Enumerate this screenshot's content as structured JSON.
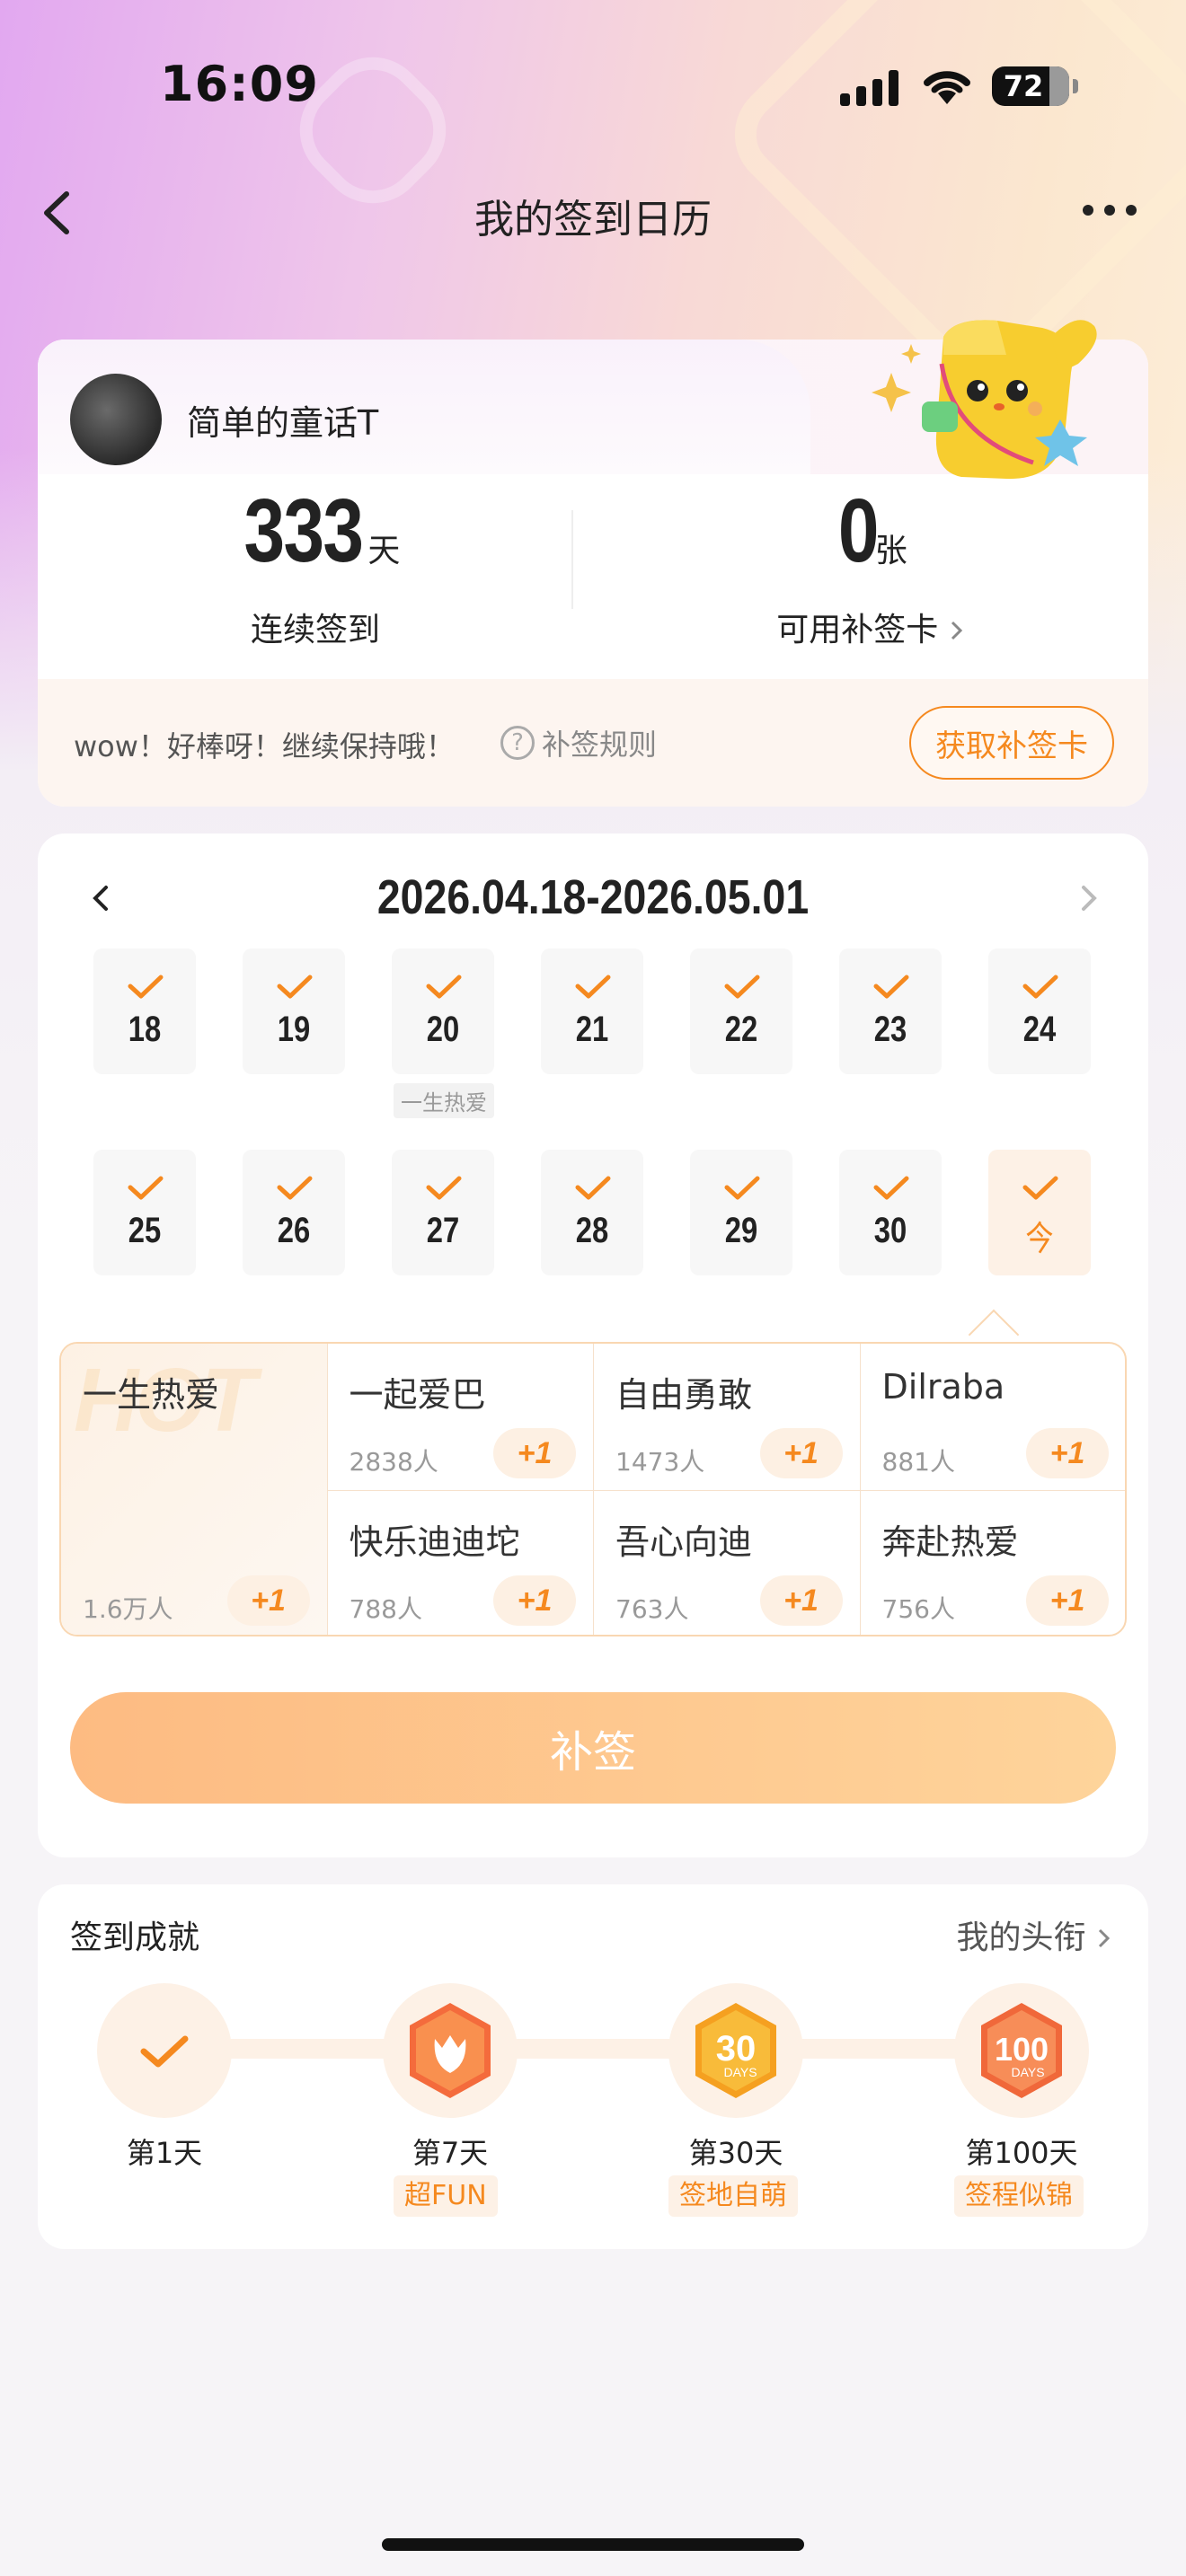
{
  "status_bar": {
    "time": "16:09",
    "battery": "72"
  },
  "nav": {
    "title": "我的签到日历",
    "back_icon": "chevron-left-icon",
    "more_icon": "more-dots-icon"
  },
  "user": {
    "name": "简单的童话T",
    "streak_value": "333",
    "streak_unit": "天",
    "streak_label": "连续签到",
    "cards_value": "0",
    "cards_unit": "张",
    "cards_label": "可用补签卡",
    "tip": "wow！好棒呀！继续保持哦！",
    "rules_label": "补签规则",
    "get_card_label": "获取补签卡"
  },
  "calendar": {
    "range": "2026.04.18-2026.05.01",
    "week1": [
      "18",
      "19",
      "20",
      "21",
      "22",
      "23",
      "24"
    ],
    "week2": [
      "25",
      "26",
      "27",
      "28",
      "29",
      "30",
      "今"
    ],
    "day20_tag": "一生热爱"
  },
  "groups": [
    {
      "name": "一生热爱",
      "count": "1.6万人",
      "plus": "+1",
      "bg_text": "HOT"
    },
    {
      "name": "一起爱巴",
      "count": "2838人",
      "plus": "+1"
    },
    {
      "name": "自由勇敢",
      "count": "1473人",
      "plus": "+1"
    },
    {
      "name": "Dilraba",
      "count": "881人",
      "plus": "+1"
    },
    {
      "name": "快乐迪迪坨",
      "count": "788人",
      "plus": "+1"
    },
    {
      "name": "吾心向迪",
      "count": "763人",
      "plus": "+1"
    },
    {
      "name": "奔赴热爱",
      "count": "756人",
      "plus": "+1"
    }
  ],
  "makeup_button": "补签",
  "achievements": {
    "title": "签到成就",
    "link": "我的头衔",
    "items": [
      {
        "label": "第1天",
        "tag": ""
      },
      {
        "label": "第7天",
        "tag": "超FUN"
      },
      {
        "label": "第30天",
        "tag": "签地自萌"
      },
      {
        "label": "第100天",
        "tag": "签程似锦"
      }
    ],
    "badge_7_text": "",
    "badge_30_text": "30",
    "badge_30_sub": "DAYS",
    "badge_100_text": "100",
    "badge_100_sub": "DAYS"
  },
  "colors": {
    "accent": "#f5891f",
    "button_from": "#fdbb82",
    "button_to": "#fed49b"
  }
}
